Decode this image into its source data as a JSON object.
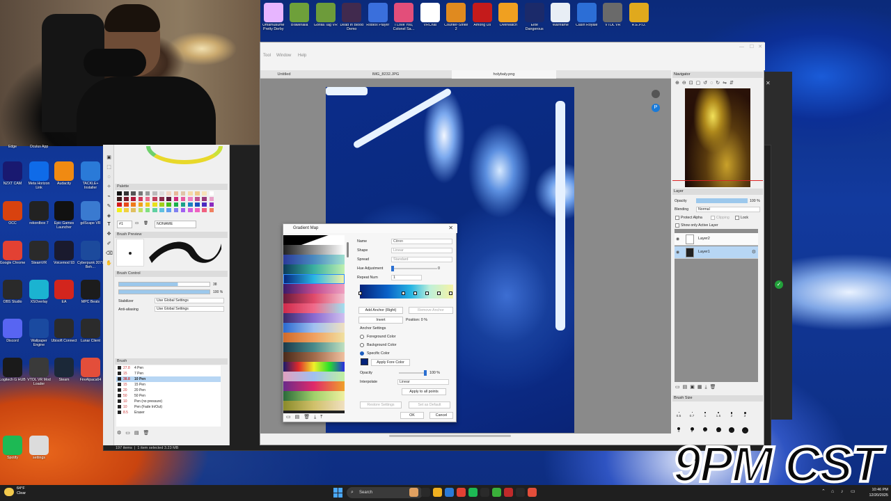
{
  "games": [
    {
      "label": "Umamusume Pretty Derby",
      "color": "#e7b5ff"
    },
    {
      "label": "Brawlhalla",
      "color": "#6ea03a"
    },
    {
      "label": "Gorilla Tag VR",
      "color": "#6d9b3a"
    },
    {
      "label": "Dead In Blood Demo",
      "color": "#412a4e"
    },
    {
      "label": "Roblox Player",
      "color": "#3a6fdc"
    },
    {
      "label": "I Love You, Colonel Sa…",
      "color": "#e34e7a"
    },
    {
      "label": "VRChat",
      "color": "#ffffff"
    },
    {
      "label": "Counter-Strike 2",
      "color": "#e08a1f"
    },
    {
      "label": "Among Us",
      "color": "#c41b1b"
    },
    {
      "label": "Overwatch",
      "color": "#f0a020"
    },
    {
      "label": "Elite Dangerous",
      "color": "#1b2a6a"
    },
    {
      "label": "Warframe",
      "color": "#e8eef5"
    },
    {
      "label": "Clash Royale",
      "color": "#2c6ed6"
    },
    {
      "label": "VTOL VR",
      "color": "#6a6a6a"
    },
    {
      "label": "R.E.P.O.",
      "color": "#e0a91d"
    }
  ],
  "desktop_icons": [
    {
      "label": "Edge",
      "color": "#1a7ac8"
    },
    {
      "label": "Oculus App",
      "color": "#2a2a2a"
    },
    {
      "label": "NZXT CAM",
      "color": "#191970"
    },
    {
      "label": "Meta Horizon Link",
      "color": "#0f6be8"
    },
    {
      "label": "Audacity",
      "color": "#f08a12"
    },
    {
      "label": "TACKLE+ Installer",
      "color": "#2a7ad8"
    },
    {
      "label": "OCC",
      "color": "#d8420f"
    },
    {
      "label": "rekordbox 7",
      "color": "#222222"
    },
    {
      "label": "Epic Games Launcher",
      "color": "#111111"
    },
    {
      "label": "gdScape VR",
      "color": "#3a7ad0"
    },
    {
      "label": "Google Chrome",
      "color": "#e34133"
    },
    {
      "label": "SteamVR",
      "color": "#2a2a2a"
    },
    {
      "label": "Voicemod 93",
      "color": "#1a1a2e"
    },
    {
      "label": "Cyberpunk 2077 Beh…",
      "color": "#1c4a9c"
    },
    {
      "label": "OBS Studio",
      "color": "#2a2a2a"
    },
    {
      "label": "XSOverlay",
      "color": "#1bb3d1"
    },
    {
      "label": "EA",
      "color": "#d3251d"
    },
    {
      "label": "MPC Beats",
      "color": "#1c1c1c"
    },
    {
      "label": "Discord",
      "color": "#5865f2"
    },
    {
      "label": "Wallpaper Engine",
      "color": "#1a4aa0"
    },
    {
      "label": "Ubisoft Connect",
      "color": "#2b2b2b"
    },
    {
      "label": "Lunar Client",
      "color": "#2b2b2b"
    },
    {
      "label": "Logitech G HUB",
      "color": "#1a1a1a"
    },
    {
      "label": "VTOL VR Mod Loader",
      "color": "#3a3a3a"
    },
    {
      "label": "Steam",
      "color": "#1b2838"
    },
    {
      "label": "FireAlpaca64",
      "color": "#e34e3a"
    },
    {
      "label": "Spotify",
      "color": "#1db954"
    },
    {
      "label": "settings",
      "color": "#dcdcdc"
    }
  ],
  "csp": {
    "menu": [
      "Tool",
      "Window",
      "Help"
    ],
    "tabs": [
      "Untitled",
      "IMG_8232.JPG",
      "holybaly.png"
    ],
    "palette_title": "Palette",
    "palette_index": "#1",
    "palette_name": "NONAME",
    "brush_preview_title": "Brush Preview",
    "brush_control_title": "Brush Control",
    "brush_size_value": "38",
    "brush_opacity_value": "100 %",
    "stabilizer_label": "Stabilizer",
    "stabilizer_value": "Use Global Settings",
    "antialias_label": "Anti-aliasing",
    "antialias_value": "Use Global Settings",
    "brush_title": "Brush",
    "brushes": [
      {
        "size": "27.8",
        "name": "4 Pen"
      },
      {
        "size": "15",
        "name": "7 Pen"
      },
      {
        "size": "38.8",
        "name": "10 Pen",
        "selected": true
      },
      {
        "size": "15",
        "name": "15 Pen"
      },
      {
        "size": "20",
        "name": "20 Pen"
      },
      {
        "size": "50",
        "name": "50 Pen"
      },
      {
        "size": "10",
        "name": "Pen (no pressure)"
      },
      {
        "size": "10",
        "name": "Pen (Fade In/Out)"
      },
      {
        "size": "8.5",
        "name": "Eraser"
      }
    ],
    "status_items": "197 items",
    "status_selected": "1 item selected 3.23 MB"
  },
  "gradient_map": {
    "title": "Gradient Map",
    "name_label": "Name",
    "name_value": "Citron",
    "shape_label": "Shape",
    "shape_value": "Linear",
    "spread_label": "Spread",
    "spread_value": "Standard",
    "hue_label": "Hue Adjustment",
    "hue_value": "0",
    "repeat_label": "Repeat Num",
    "repeat_value": "1",
    "add_anchor": "Add Anchor (Right)",
    "remove_anchor": "Remove Anchor",
    "invert": "Invert",
    "position_label": "Position: 0 %",
    "anchor_settings": "Anchor Settings",
    "foreground_color": "Foreground Color",
    "background_color": "Background Color",
    "specific_color": "Specific Color",
    "apply_fore_color": "Apply Fore Color",
    "opacity_label": "Opacity",
    "opacity_value": "100 %",
    "interpolate_label": "Interpolate",
    "interpolate_value": "Linear",
    "apply_all": "Apply to all points",
    "restore_settings": "Restore Settings",
    "set_as_default": "Set as Default",
    "ok": "OK",
    "cancel": "Cancel"
  },
  "navigator": {
    "title": "Navigator"
  },
  "layer": {
    "title": "Layer",
    "opacity_label": "Opacity",
    "opacity_value": "100 %",
    "blending_label": "Blending",
    "blending_value": "Normal",
    "protect_alpha": "Protect Alpha",
    "clipping": "Clipping",
    "lock": "Lock",
    "show_only_active": "Show only Active Layer",
    "layers": [
      {
        "name": "Layer2",
        "selected": false
      },
      {
        "name": "Layer1",
        "selected": true
      }
    ]
  },
  "brush_size": {
    "title": "Brush Size",
    "sizes": [
      "0.5",
      "0.7",
      "1",
      "1.5",
      "2",
      "3",
      "4",
      "5",
      "7",
      "10",
      "12",
      "15"
    ]
  },
  "overlay_time": "9PM CST",
  "taskbar": {
    "weather_temp": "64°F",
    "weather_desc": "Clear",
    "search_placeholder": "Search",
    "time": "10:46 PM",
    "date": "12/20/2025"
  }
}
